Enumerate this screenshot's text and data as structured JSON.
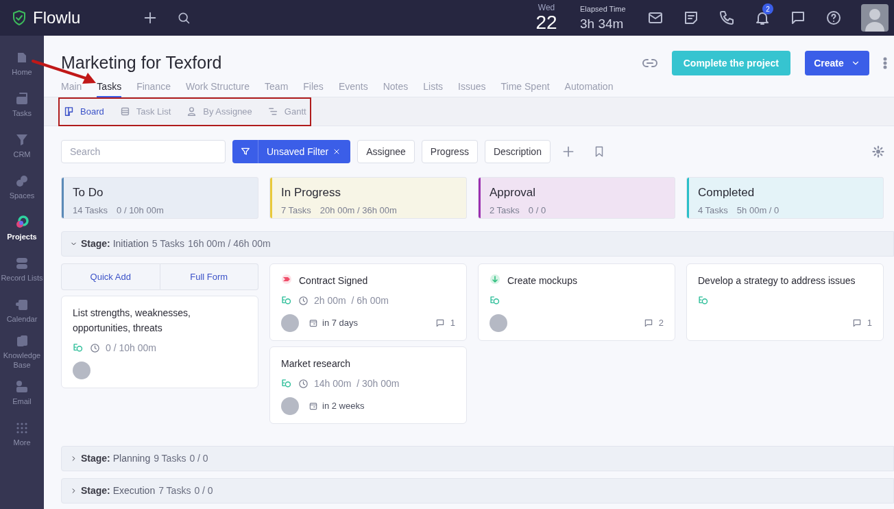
{
  "app": {
    "name": "Flowlu"
  },
  "clock": {
    "day": "Wed",
    "date": "22",
    "elapsed_label": "Elapsed Time",
    "elapsed": "3h 34m"
  },
  "notifications": {
    "badge": "2"
  },
  "sidebar": {
    "items": [
      {
        "label": "Home",
        "selected": false
      },
      {
        "label": "Tasks",
        "selected": false
      },
      {
        "label": "CRM",
        "selected": false
      },
      {
        "label": "Spaces",
        "selected": false
      },
      {
        "label": "Projects",
        "selected": true
      },
      {
        "label": "Record Lists",
        "selected": false
      },
      {
        "label": "Calendar",
        "selected": false
      },
      {
        "label": "Knowledge Base",
        "selected": false
      },
      {
        "label": "Email",
        "selected": false
      },
      {
        "label": "More",
        "selected": false
      }
    ]
  },
  "project": {
    "title": "Marketing for Texford",
    "complete_button": "Complete the project",
    "create_button": "Create"
  },
  "tabs": [
    {
      "label": "Main",
      "selected": false
    },
    {
      "label": "Tasks",
      "selected": true
    },
    {
      "label": "Finance",
      "selected": false
    },
    {
      "label": "Work Structure",
      "selected": false
    },
    {
      "label": "Team",
      "selected": false
    },
    {
      "label": "Files",
      "selected": false
    },
    {
      "label": "Events",
      "selected": false
    },
    {
      "label": "Notes",
      "selected": false
    },
    {
      "label": "Lists",
      "selected": false
    },
    {
      "label": "Issues",
      "selected": false
    },
    {
      "label": "Time Spent",
      "selected": false
    },
    {
      "label": "Automation",
      "selected": false
    }
  ],
  "views": [
    {
      "label": "Board",
      "kind": "board",
      "selected": true
    },
    {
      "label": "Task List",
      "kind": "list",
      "selected": false
    },
    {
      "label": "By Assignee",
      "kind": "assignee",
      "selected": false
    },
    {
      "label": "Gantt",
      "kind": "gantt",
      "selected": false
    }
  ],
  "filters": {
    "search_placeholder": "Search",
    "active_filter": "Unsaved Filter",
    "chips": [
      "Assignee",
      "Progress",
      "Description"
    ]
  },
  "columns": [
    {
      "title": "To Do",
      "tasks": "14 Tasks",
      "time": "0 / 10h 00m",
      "color": "#5b8ab8"
    },
    {
      "title": "In Progress",
      "tasks": "7 Tasks",
      "time": "20h 00m / 36h 00m",
      "color": "#e8c93a"
    },
    {
      "title": "Approval",
      "tasks": "2 Tasks",
      "time": "0 / 0",
      "color": "#9b30b0"
    },
    {
      "title": "Completed",
      "tasks": "4 Tasks",
      "time": "5h 00m / 0",
      "color": "#2bbfc8"
    }
  ],
  "stages": [
    {
      "label": "Stage:",
      "name": "Initiation",
      "tasks": "5 Tasks",
      "time": "16h 00m / 46h 00m",
      "expanded": true,
      "quick_add": "Quick Add",
      "full_form": "Full Form",
      "lanes": [
        [
          {
            "title": "List strengths, weaknesses, opportunities, threats",
            "kind": "plain",
            "time": "0 / 10h 00m",
            "assignee": true
          }
        ],
        [
          {
            "title": "Contract Signed",
            "kind": "urgent",
            "time": "2h 00m  / 6h 00m",
            "due": "in 7 days",
            "comments": "1",
            "assignee": true
          },
          {
            "title": "Market research",
            "kind": "plain",
            "time": "14h 00m  / 30h 00m",
            "due": "in 2 weeks",
            "assignee": true
          }
        ],
        [
          {
            "title": "Create mockups",
            "kind": "minor",
            "comments": "2",
            "assignee": true
          }
        ],
        [
          {
            "title": "Develop a strategy to address issues",
            "kind": "plain",
            "comments": "1",
            "assignee": false
          }
        ]
      ]
    },
    {
      "label": "Stage:",
      "name": "Planning",
      "tasks": "9 Tasks",
      "time": "0 / 0",
      "expanded": false
    },
    {
      "label": "Stage:",
      "name": "Execution",
      "tasks": "7 Tasks",
      "time": "0 / 0",
      "expanded": false
    }
  ]
}
